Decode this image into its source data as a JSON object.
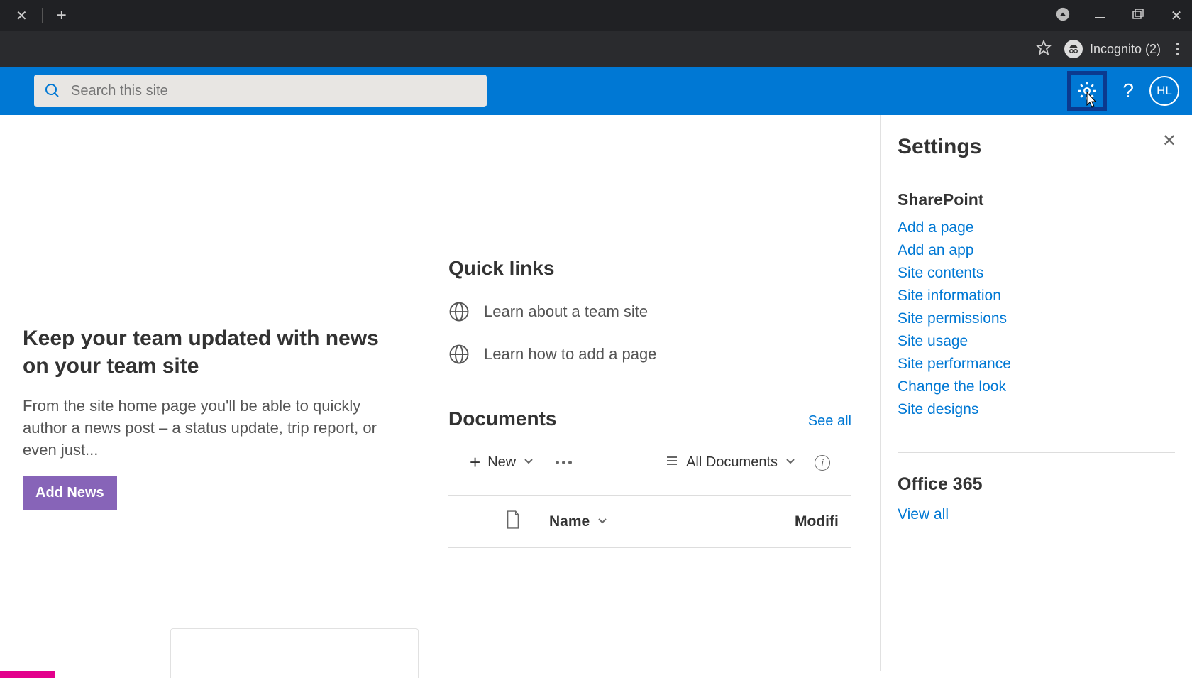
{
  "browser": {
    "incognito_label": "Incognito (2)"
  },
  "suite": {
    "search_placeholder": "Search this site",
    "avatar_initials": "HL"
  },
  "news": {
    "title": "Keep your team updated with news on your team site",
    "body": "From the site home page you'll be able to quickly author a news post – a status update, trip report, or even just...",
    "button": "Add News"
  },
  "quicklinks": {
    "heading": "Quick links",
    "items": [
      "Learn about a team site",
      "Learn how to add a page"
    ]
  },
  "documents": {
    "heading": "Documents",
    "see_all": "See all",
    "new_label": "New",
    "view_label": "All Documents",
    "col_name": "Name",
    "col_modified": "Modifi"
  },
  "settings": {
    "title": "Settings",
    "sharepoint_heading": "SharePoint",
    "links": [
      "Add a page",
      "Add an app",
      "Site contents",
      "Site information",
      "Site permissions",
      "Site usage",
      "Site performance",
      "Change the look",
      "Site designs"
    ],
    "office_heading": "Office 365",
    "view_all": "View all"
  }
}
